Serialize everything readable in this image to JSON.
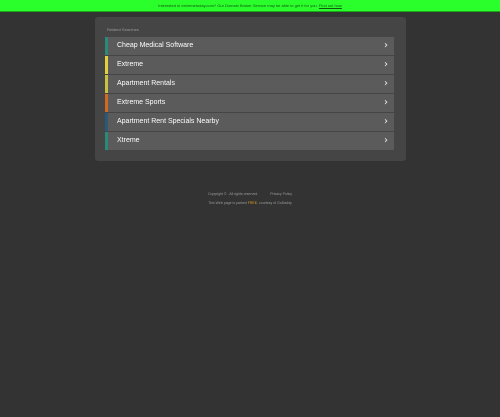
{
  "topbar": {
    "message": "Interested in extremetoday.com? Our Domain Broker Service may be able to get it for you.",
    "link_label": "Find out how"
  },
  "panel": {
    "heading": "Related Searches",
    "items": [
      {
        "label": "Cheap Medical Software",
        "accent": "#2a8a7a"
      },
      {
        "label": "Extreme",
        "accent": "#e0d040"
      },
      {
        "label": "Apartment Rentals",
        "accent": "#c8c040"
      },
      {
        "label": "Extreme Sports",
        "accent": "#d06a20"
      },
      {
        "label": "Apartment Rent Specials Nearby",
        "accent": "#2a5a7a"
      },
      {
        "label": "Xtreme",
        "accent": "#2a8a7a"
      }
    ],
    "chevron_icon": "chevron-right-icon"
  },
  "footer": {
    "copyright": "Copyright © . All rights reserved.",
    "privacy_label": "Privacy Policy",
    "notice_prefix": "This Web page is parked",
    "notice_link": "FREE",
    "notice_suffix": ", courtesy of GoDaddy"
  },
  "colors": {
    "background": "#333333",
    "topbar": "#2bff2b",
    "panel": "#454545",
    "item": "#5b5b5b"
  }
}
